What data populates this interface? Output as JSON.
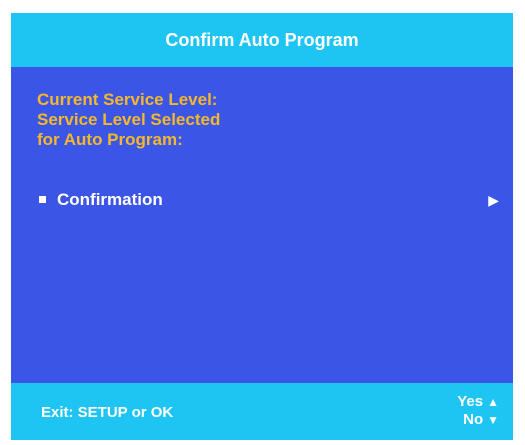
{
  "header": {
    "title": "Confirm Auto Program"
  },
  "info": {
    "line1": "Current Service Level:",
    "line2": "Service Level Selected",
    "line3": "for Auto Program:"
  },
  "menu": {
    "items": [
      {
        "label": "Confirmation",
        "arrow_icon": "triangle-right-icon",
        "bullet_icon": "square-bullet-icon"
      }
    ]
  },
  "footer": {
    "exit_hint": "Exit:  SETUP or OK",
    "yes_label": "Yes",
    "no_label": "No",
    "yes_icon": "triangle-up-icon",
    "no_icon": "triangle-down-icon"
  },
  "colors": {
    "background": "#3b55e6",
    "bar": "#1ec5f2",
    "info_text": "#f5b82b",
    "text": "#ffffff"
  }
}
